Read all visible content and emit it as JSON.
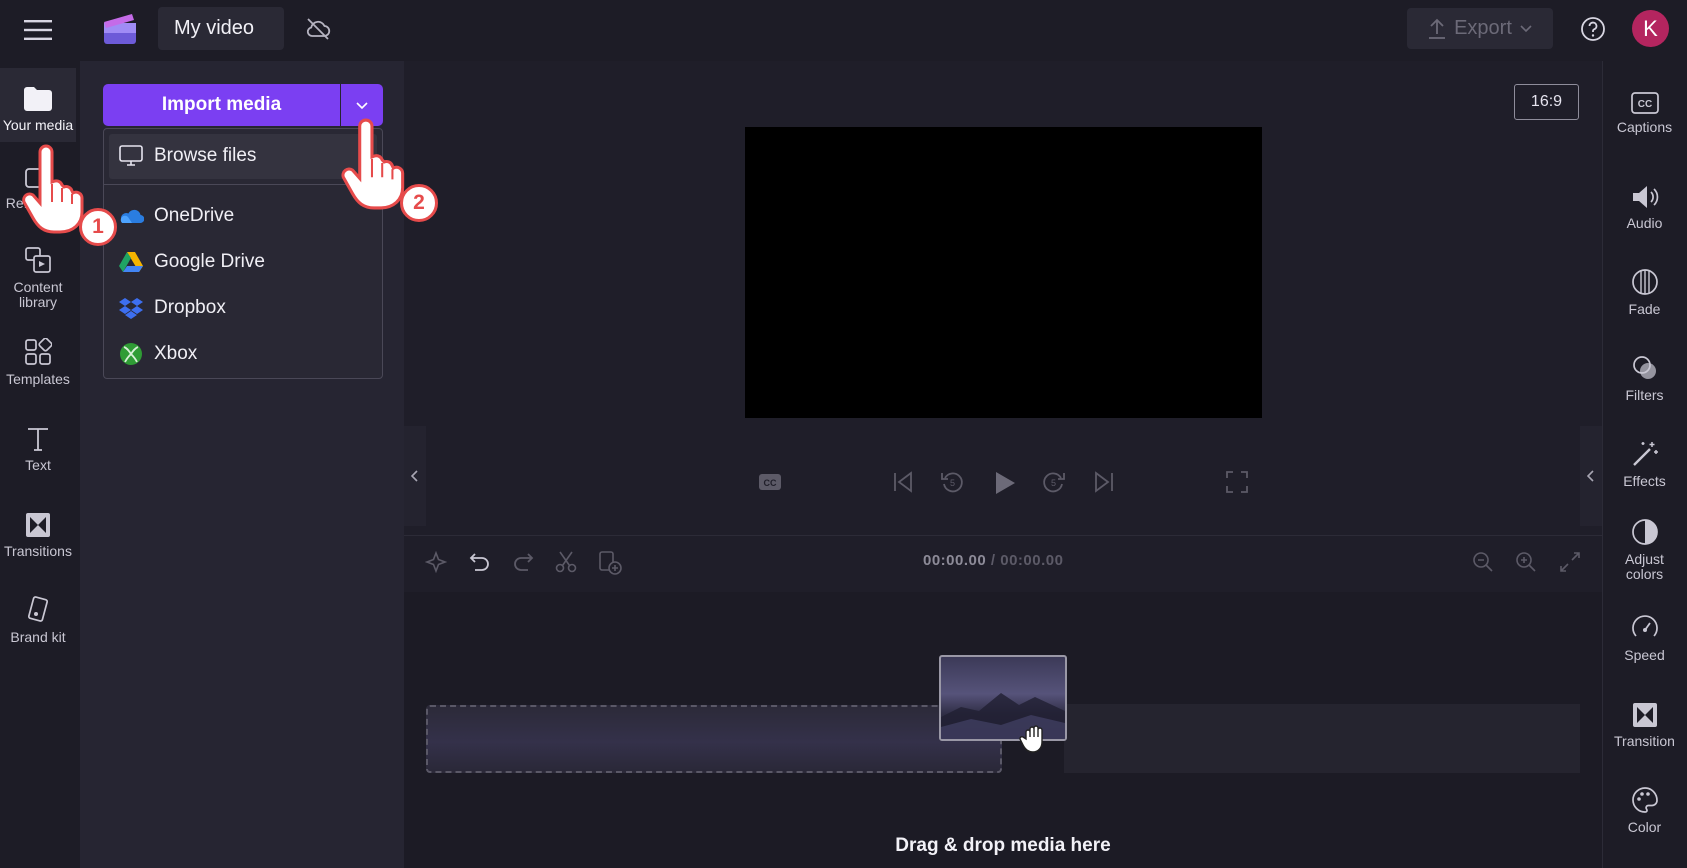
{
  "topbar": {
    "project_title": "My video",
    "export_label": "Export",
    "avatar_initial": "K"
  },
  "leftnav": {
    "items": [
      {
        "label": "Your media",
        "icon": "folder-icon"
      },
      {
        "label": "Record & create",
        "visible_label": "Re... cre...",
        "icon": "record-icon"
      },
      {
        "label": "Content library",
        "icon": "content-library-icon"
      },
      {
        "label": "Templates",
        "icon": "templates-icon"
      },
      {
        "label": "Text",
        "icon": "text-icon"
      },
      {
        "label": "Transitions",
        "icon": "transitions-icon"
      },
      {
        "label": "Brand kit",
        "icon": "brand-kit-icon"
      }
    ]
  },
  "media_panel": {
    "import_label": "Import media",
    "menu": [
      {
        "label": "Browse files",
        "icon": "monitor-icon"
      },
      {
        "label": "OneDrive",
        "icon": "onedrive-icon"
      },
      {
        "label": "Google Drive",
        "icon": "google-drive-icon"
      },
      {
        "label": "Dropbox",
        "icon": "dropbox-icon"
      },
      {
        "label": "Xbox",
        "icon": "xbox-icon"
      }
    ]
  },
  "stage": {
    "aspect_ratio": "16:9"
  },
  "timeline": {
    "current_time": "00:00.00",
    "separator": "/",
    "duration": "00:00.00",
    "drop_text": "Drag & drop media here"
  },
  "rightpanel": {
    "items": [
      {
        "label": "Captions",
        "icon": "captions-icon"
      },
      {
        "label": "Audio",
        "icon": "speaker-icon"
      },
      {
        "label": "Fade",
        "icon": "fade-icon"
      },
      {
        "label": "Filters",
        "icon": "filters-icon"
      },
      {
        "label": "Effects",
        "icon": "magic-wand-icon"
      },
      {
        "label": "Adjust colors",
        "icon": "adjust-colors-icon"
      },
      {
        "label": "Speed",
        "icon": "speedometer-icon"
      },
      {
        "label": "Transition",
        "icon": "transition-icon"
      },
      {
        "label": "Color",
        "icon": "palette-icon"
      }
    ]
  },
  "annotations": {
    "step1": "1",
    "step2": "2"
  },
  "colors": {
    "accent": "#7b3ff2",
    "background": "#1d1c26",
    "avatar": "#b4255f",
    "step_badge": "#e64b4b"
  }
}
